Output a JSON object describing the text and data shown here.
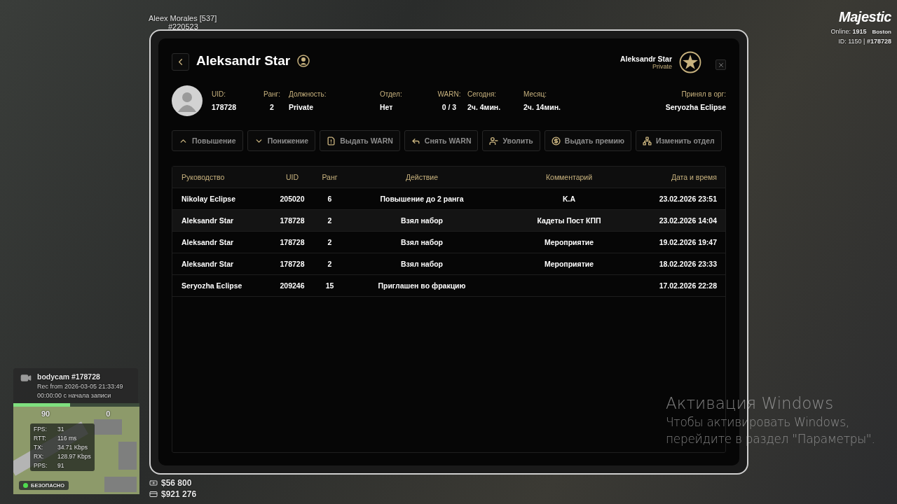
{
  "hud": {
    "player_name": "Aleex Morales [537]",
    "player_id": "#220523",
    "logo": "Majestic",
    "online": "Online: **1915**",
    "server": "Boston",
    "id_line": "ID: 1150 | **#178728**"
  },
  "bodycam": {
    "title": "bodycam #178728",
    "rec": "Rec from 2026-03-05 21:33:49",
    "elapsed": "00:00:00 с начала записи"
  },
  "minimap": {
    "compass": [
      "90",
      "0"
    ],
    "stats": [
      {
        "label": "FPS:",
        "value": "31"
      },
      {
        "label": "RTT:",
        "value": "116 ms"
      },
      {
        "label": "TX:",
        "value": "34.71 Kbps"
      },
      {
        "label": "RX:",
        "value": "128.97 Kbps"
      },
      {
        "label": "PPS:",
        "value": "91"
      }
    ],
    "zone": "БЕЗОПАСНО"
  },
  "money": [
    {
      "kind": "cash",
      "amount": "$56 800"
    },
    {
      "kind": "card",
      "amount": "$921 276"
    }
  ],
  "windows_notice": {
    "title": "Активация Windows",
    "lines": [
      "Чтобы активировать Windows,",
      "перейдите в раздел \"Параметры\"."
    ]
  },
  "modal": {
    "title": "Aleksandr Star",
    "badge": {
      "name": "Aleksandr Star",
      "rank": "Private"
    },
    "fields": [
      {
        "label": "UID:",
        "value": "178728"
      },
      {
        "label": "Ранг:",
        "value": "2"
      },
      {
        "label": "Должность:",
        "value": "Private"
      },
      {
        "label": "Отдел:",
        "value": "Нет"
      },
      {
        "label": "WARN:",
        "value": "0 / 3"
      },
      {
        "label": "Сегодня:",
        "value": "2ч. 4мин."
      },
      {
        "label": "Месяц:",
        "value": "2ч. 14мин."
      }
    ],
    "accepted": {
      "label": "Принял в орг:",
      "value": "Seryozha Eclipse"
    },
    "actions": [
      "Повышение",
      "Понижение",
      "Выдать WARN",
      "Снять WARN",
      "Уволить",
      "Выдать премию",
      "Изменить отдел"
    ],
    "table": {
      "columns": [
        "Руководство",
        "UID",
        "Ранг",
        "Действие",
        "Комментарий",
        "Дата и время"
      ],
      "rows": [
        {
          "cells": [
            "Nikolay Eclipse",
            "205020",
            "6",
            "Повышение до 2 ранга",
            "K.A",
            "23.02.2026 23:51"
          ],
          "selected": false
        },
        {
          "cells": [
            "Aleksandr Star",
            "178728",
            "2",
            "Взял набор",
            "Кадеты Пост КПП",
            "23.02.2026 14:04"
          ],
          "selected": true
        },
        {
          "cells": [
            "Aleksandr Star",
            "178728",
            "2",
            "Взял набор",
            "Мероприятие",
            "19.02.2026 19:47"
          ],
          "selected": false
        },
        {
          "cells": [
            "Aleksandr Star",
            "178728",
            "2",
            "Взял набор",
            "Мероприятие",
            "18.02.2026 23:33"
          ],
          "selected": false
        },
        {
          "cells": [
            "Seryozha Eclipse",
            "209246",
            "15",
            "Приглашен во фракцию",
            "",
            "17.02.2026 22:28"
          ],
          "selected": false
        }
      ]
    }
  }
}
